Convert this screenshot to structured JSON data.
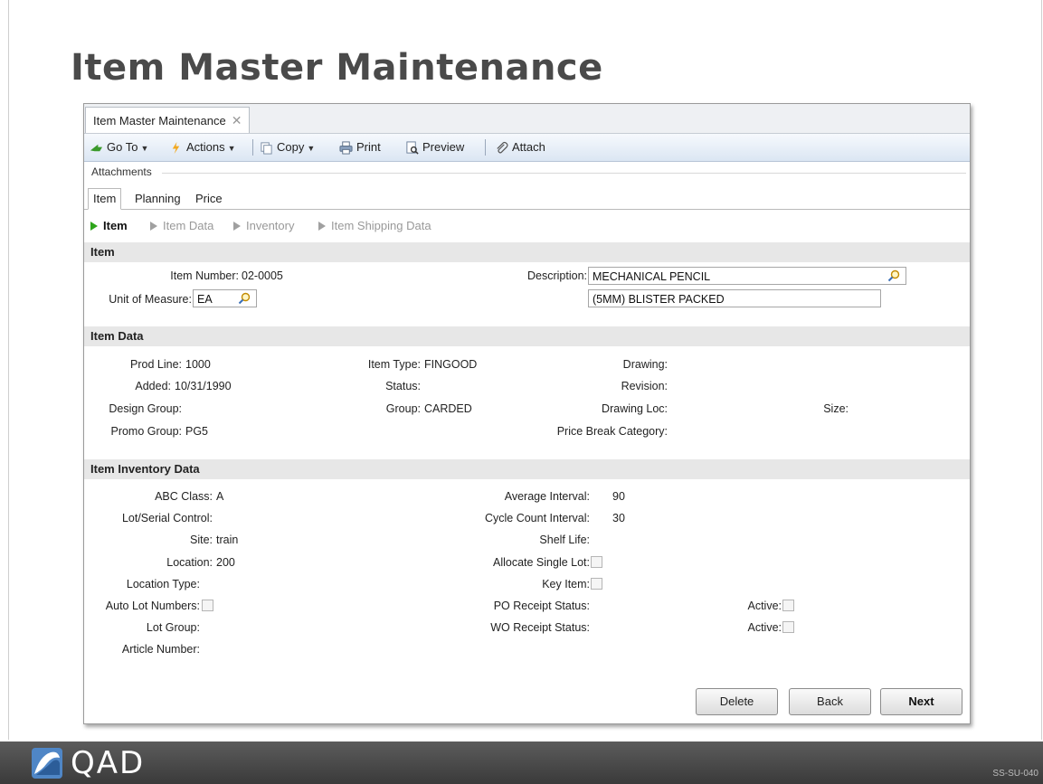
{
  "slide": {
    "title": "Item Master Maintenance",
    "code": "SS-SU-040",
    "logo_text": "QAD"
  },
  "window": {
    "tab_label": "Item Master Maintenance",
    "close_symbol": "✕"
  },
  "toolbar": {
    "goto": "Go To",
    "actions": "Actions",
    "copy": "Copy",
    "print": "Print",
    "preview": "Preview",
    "attach": "Attach"
  },
  "attachments_label": "Attachments",
  "subtabs": [
    "Item",
    "Planning",
    "Price"
  ],
  "crumbs": [
    "Item",
    "Item Data",
    "Inventory",
    "Item Shipping Data"
  ],
  "item": {
    "header": "Item",
    "item_number_label": "Item Number:",
    "item_number": "02-0005",
    "uom_label": "Unit of Measure:",
    "uom": "EA",
    "description_label": "Description:",
    "description1": "MECHANICAL PENCIL",
    "description2": "(5MM) BLISTER PACKED"
  },
  "item_data": {
    "header": "Item Data",
    "prod_line_label": "Prod Line:",
    "prod_line": "1000",
    "added_label": "Added:",
    "added": "10/31/1990",
    "design_group_label": "Design Group:",
    "promo_group_label": "Promo Group:",
    "promo_group": "PG5",
    "item_type_label": "Item Type:",
    "item_type": "FINGOOD",
    "status_label": "Status:",
    "group_label": "Group:",
    "group": "CARDED",
    "drawing_label": "Drawing:",
    "revision_label": "Revision:",
    "drawing_loc_label": "Drawing Loc:",
    "price_break_label": "Price Break Category:",
    "size_label": "Size:"
  },
  "inventory": {
    "header": "Item Inventory Data",
    "abc_label": "ABC Class:",
    "abc": "A",
    "lot_serial_label": "Lot/Serial Control:",
    "site_label": "Site:",
    "site": "train",
    "location_label": "Location:",
    "location": "200",
    "location_type_label": "Location Type:",
    "auto_lot_label": "Auto Lot Numbers:",
    "lot_group_label": "Lot Group:",
    "article_label": "Article Number:",
    "avg_interval_label": "Average Interval:",
    "avg_interval": "90",
    "cycle_count_label": "Cycle Count Interval:",
    "cycle_count": "30",
    "shelf_life_label": "Shelf Life:",
    "alloc_single_label": "Allocate Single Lot:",
    "key_item_label": "Key Item:",
    "po_receipt_label": "PO Receipt Status:",
    "wo_receipt_label": "WO Receipt Status:",
    "active_label": "Active:"
  },
  "buttons": {
    "delete": "Delete",
    "back": "Back",
    "next": "Next"
  },
  "colors": {
    "section_bg": "#e7e7e7",
    "active_crumb": "#2ea51b",
    "footer": "#4a4a4a"
  }
}
